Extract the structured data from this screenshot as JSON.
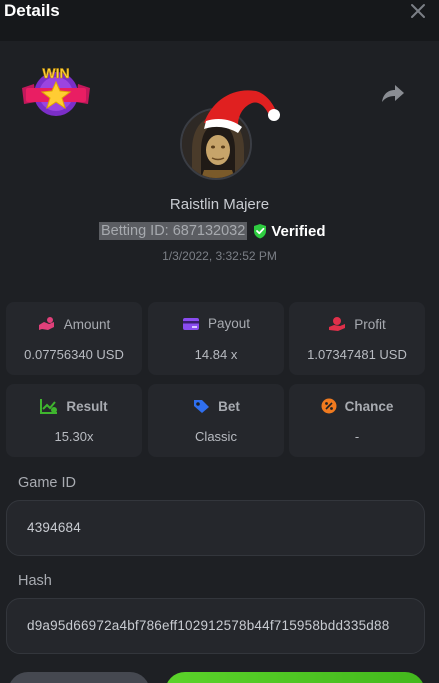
{
  "header": {
    "title": "Details"
  },
  "player": {
    "name": "Raistlin Majere",
    "betting_id": "Betting ID: 687132032",
    "verified_label": "Verified",
    "date": "1/3/2022, 3:32:52 PM"
  },
  "badge": {
    "text": "WIN"
  },
  "stats": [
    {
      "label": "Amount",
      "value": "0.07756340 USD",
      "icon": "amount-icon"
    },
    {
      "label": "Payout",
      "value": "14.84 x",
      "icon": "payout-card-icon"
    },
    {
      "label": "Profit",
      "value": "1.07347481 USD",
      "icon": "profit-icon"
    },
    {
      "label": "Result",
      "value": "15.30x",
      "icon": "result-chart-icon"
    },
    {
      "label": "Bet",
      "value": "Classic",
      "icon": "bet-tag-icon"
    },
    {
      "label": "Chance",
      "value": "-",
      "icon": "chance-percent-icon"
    }
  ],
  "game": {
    "label": "Game ID",
    "value": "4394684"
  },
  "hash": {
    "label": "Hash",
    "value": "d9a95d66972a4bf786eff102912578b44f715958bdd335d88"
  },
  "colors": {
    "verified": "#2ecc40",
    "accent_green": "#4fc524",
    "amount_icon": "#e0407a",
    "payout_icon": "#8a4cf0",
    "profit_icon": "#e0304a",
    "result_icon": "#3fb52e",
    "bet_icon": "#2f6ff0",
    "chance_icon": "#f07a1f"
  }
}
